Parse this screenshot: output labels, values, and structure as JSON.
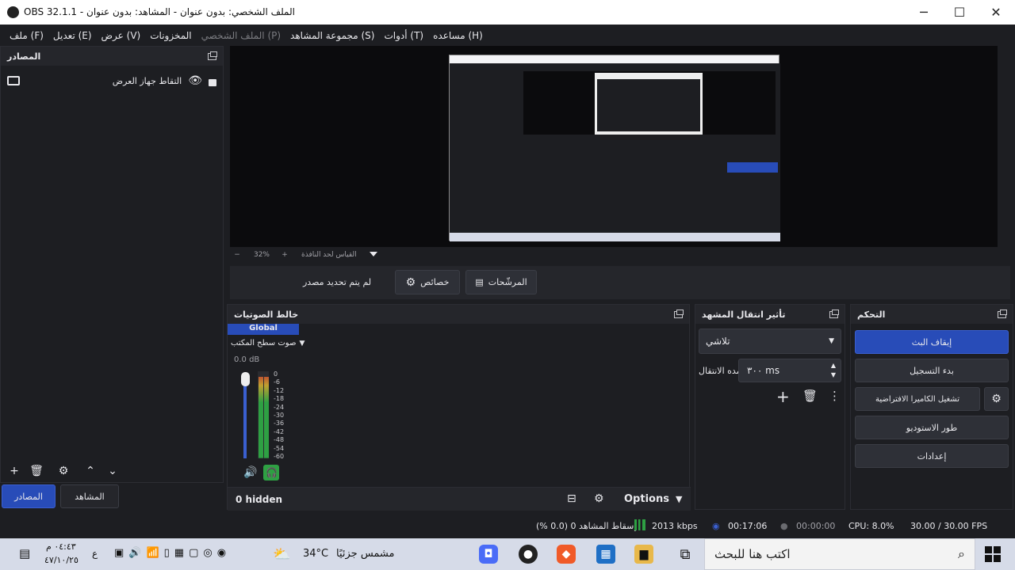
{
  "window": {
    "title": "OBS 32.1.1 - الملف الشخصي: بدون عنوان - المشاهد: بدون عنوان",
    "minimize": "─",
    "maximize": "☐",
    "close": "✕"
  },
  "menu": [
    "ملف (F)",
    "تعديل (E)",
    "عرض (V)",
    "المخزونات",
    "الملف الشخصي (P)",
    "مجموعة المشاهد (S)",
    "أدوات (T)",
    "مساعده (H)"
  ],
  "sources": {
    "title": "المصادر",
    "item": "التقاط جهاز العرض",
    "tab_sources": "المصادر",
    "tab_scenes": "المشاهد"
  },
  "preview": {
    "zoom": "32%",
    "fit": "القياس لحد النافذة",
    "minus": "−",
    "plus": "+"
  },
  "source_bar": {
    "no_source": "لم يتم تحديد مصدر",
    "properties": "خصائص",
    "filters": "المرشّحات"
  },
  "mixer": {
    "title": "خالط الصوتيات",
    "tab": "Global",
    "channel": "صوت سطح المكتب",
    "db": "0.0 dB",
    "scale": [
      "0",
      "-6",
      "-12",
      "-18",
      "-24",
      "-30",
      "-36",
      "-42",
      "-48",
      "-54",
      "-60"
    ],
    "level": 0.95,
    "hidden": "0 hidden",
    "options": "Options"
  },
  "transitions": {
    "title": "تأثير انتقال المشهد",
    "type": "تلاشي",
    "duration_label": "مده الانتقال",
    "duration": "٣٠٠ ms"
  },
  "controls": {
    "title": "التحكم",
    "stop_stream": "إيقاف البث",
    "start_recording": "بدء التسجيل",
    "virtual_cam": "تشغيل الكاميرا الافتراضية",
    "studio_mode": "طور الاستوديو",
    "settings": "إعدادات"
  },
  "status": {
    "dropped": "إسقاط المشاهد 0 (0.0 %)",
    "bitrate": "2013 kbps",
    "stream_time": "00:17:06",
    "rec_time": "00:00:00",
    "cpu": "CPU: 8.0%",
    "fps": "30.00 / 30.00 FPS"
  },
  "taskbar": {
    "search": "اكتب هنا للبحث",
    "weather_temp": "34°C",
    "weather_text": "مشمس جزئيًا",
    "time": "٠٤:٤٣ م",
    "date": "٤٧/١٠/٢٥",
    "lang": "ع"
  },
  "colors": {
    "accent": "#284cb8",
    "bg": "#1d1e22",
    "green": "#2ea043"
  }
}
